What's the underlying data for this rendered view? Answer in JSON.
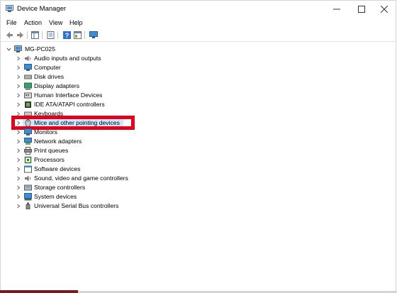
{
  "window": {
    "title": "Device Manager",
    "controls": [
      "minimize",
      "maximize",
      "close"
    ]
  },
  "menu": [
    "File",
    "Action",
    "View",
    "Help"
  ],
  "toolbar": [
    "back-icon",
    "forward-icon",
    "properties-icon",
    "update-driver-icon",
    "help-icon",
    "view-icon",
    "monitor-icon"
  ],
  "tree": {
    "root": "MG-PC025",
    "items": [
      {
        "label": "Audio inputs and outputs",
        "icon": "speaker-icon"
      },
      {
        "label": "Computer",
        "icon": "computer-icon"
      },
      {
        "label": "Disk drives",
        "icon": "disk-icon"
      },
      {
        "label": "Display adapters",
        "icon": "display-adapter-icon"
      },
      {
        "label": "Human Interface Devices",
        "icon": "hid-icon"
      },
      {
        "label": "IDE ATA/ATAPI controllers",
        "icon": "ide-icon"
      },
      {
        "label": "Keyboards",
        "icon": "keyboard-icon"
      },
      {
        "label": "Mice and other pointing devices",
        "icon": "mouse-icon",
        "selected": true
      },
      {
        "label": "Monitors",
        "icon": "monitor-icon"
      },
      {
        "label": "Network adapters",
        "icon": "network-icon"
      },
      {
        "label": "Print queues",
        "icon": "printer-icon"
      },
      {
        "label": "Processors",
        "icon": "processor-icon"
      },
      {
        "label": "Software devices",
        "icon": "software-icon"
      },
      {
        "label": "Sound, video and game controllers",
        "icon": "sound-icon"
      },
      {
        "label": "Storage controllers",
        "icon": "storage-icon"
      },
      {
        "label": "System devices",
        "icon": "system-icon"
      },
      {
        "label": "Universal Serial Bus controllers",
        "icon": "usb-icon"
      }
    ]
  },
  "colors": {
    "selection": "#cce8ff",
    "highlight_box": "#e3001b"
  }
}
